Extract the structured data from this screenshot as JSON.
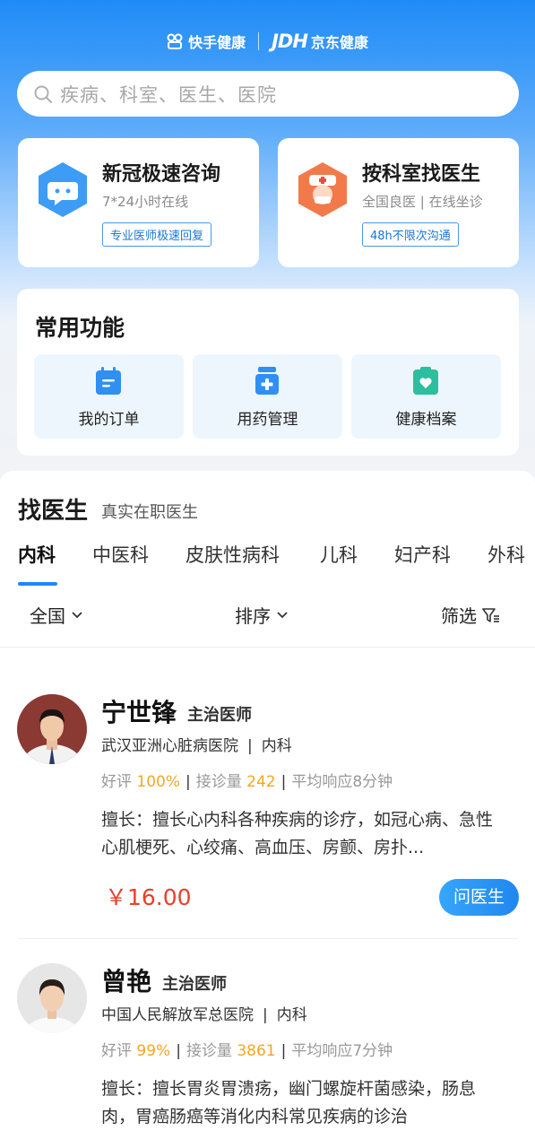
{
  "header": {
    "brand_kuaishou": "快手健康",
    "brand_jd": "JDH",
    "brand_jd_health": "京东健康"
  },
  "search": {
    "placeholder": "疾病、科室、医生、医院"
  },
  "cards": [
    {
      "title": "新冠极速咨询",
      "subtitle": "7*24小时在线",
      "tag": "专业医师极速回复",
      "icon": "chat-bubble-icon"
    },
    {
      "title": "按科室找医生",
      "subtitle": "全国良医 | 在线坐诊",
      "tag": "48h不限次沟通",
      "icon": "nurse-icon"
    }
  ],
  "common_functions": {
    "title": "常用功能",
    "items": [
      {
        "label": "我的订单",
        "icon": "order-icon"
      },
      {
        "label": "用药管理",
        "icon": "medicine-icon"
      },
      {
        "label": "健康档案",
        "icon": "health-record-icon"
      }
    ]
  },
  "find_doctor": {
    "title": "找医生",
    "subtitle": "真实在职医生",
    "tabs": [
      "内科",
      "中医科",
      "皮肤性病科",
      "儿科",
      "妇产科",
      "外科"
    ],
    "active_tab": "内科",
    "filters": {
      "region": "全国",
      "sort": "排序",
      "filter": "筛选"
    }
  },
  "doctors": [
    {
      "name": "宁世锋",
      "title": "主治医师",
      "hospital": "武汉亚洲心脏病医院",
      "department": "内科",
      "rating_label": "好评",
      "rating": "100%",
      "consult_label": "接诊量",
      "consults": "242",
      "response": "平均响应8分钟",
      "specialty": "擅长：擅长心内科各种疾病的诊疗，如冠心病、急性心肌梗死、心绞痛、高血压、房颤、房扑...",
      "price": "￥16.00",
      "button": "问医生"
    },
    {
      "name": "曾艳",
      "title": "主治医师",
      "hospital": "中国人民解放军总医院",
      "department": "内科",
      "rating_label": "好评",
      "rating": "99%",
      "consult_label": "接诊量",
      "consults": "3861",
      "response": "平均响应7分钟",
      "specialty": "擅长：擅长胃炎胃溃疡，幽门螺旋杆菌感染，肠息肉，胃癌肠癌等消化内科常见疾病的诊治"
    }
  ],
  "colors": {
    "brand_blue": "#1f88f3",
    "price_red": "#e8402c",
    "rating_orange": "#f5a623"
  }
}
